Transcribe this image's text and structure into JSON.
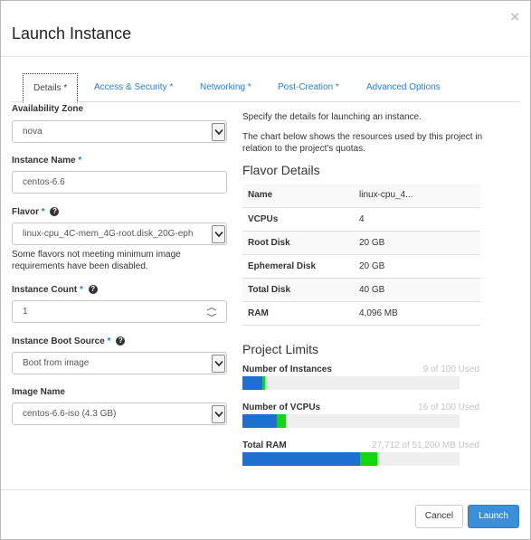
{
  "dialog": {
    "title": "Launch Instance",
    "close_glyph": "×"
  },
  "tabs": [
    {
      "label": "Details *",
      "active": true
    },
    {
      "label": "Access & Security *",
      "active": false
    },
    {
      "label": "Networking *",
      "active": false
    },
    {
      "label": "Post-Creation *",
      "active": false
    },
    {
      "label": "Advanced Options",
      "active": false
    }
  ],
  "form": {
    "availability_zone": {
      "label": "Availability Zone",
      "value": "nova"
    },
    "instance_name": {
      "label": "Instance Name",
      "required": "*",
      "value": "centos-6.6"
    },
    "flavor": {
      "label": "Flavor",
      "required": "*",
      "value": "linux-cpu_4C-mem_4G-root.disk_20G-eph",
      "note": "Some flavors not meeting minimum image requirements have been disabled."
    },
    "instance_count": {
      "label": "Instance Count",
      "required": "*",
      "value": "1"
    },
    "boot_source": {
      "label": "Instance Boot Source",
      "required": "*",
      "value": "Boot from image"
    },
    "image_name": {
      "label": "Image Name",
      "value": "centos-6.6-iso (4.3 GB)"
    }
  },
  "help": {
    "text1": "Specify the details for launching an instance.",
    "text2": "The chart below shows the resources used by this project in relation to the project's quotas."
  },
  "flavor_details": {
    "title": "Flavor Details",
    "rows": [
      {
        "key": "Name",
        "value": "linux-cpu_4..."
      },
      {
        "key": "VCPUs",
        "value": "4"
      },
      {
        "key": "Root Disk",
        "value": "20 GB"
      },
      {
        "key": "Ephemeral Disk",
        "value": "20 GB"
      },
      {
        "key": "Total Disk",
        "value": "40 GB"
      },
      {
        "key": "RAM",
        "value": "4,096 MB"
      }
    ]
  },
  "project_limits": {
    "title": "Project Limits",
    "items": [
      {
        "label": "Number of Instances",
        "used_text": "9 of 100 Used",
        "used": 9,
        "adding": 1,
        "total": 100
      },
      {
        "label": "Number of VCPUs",
        "used_text": "16 of 100 Used",
        "used": 16,
        "adding": 4,
        "total": 100
      },
      {
        "label": "Total RAM",
        "used_text": "27,712 of 51,200 MB Used",
        "used": 27712,
        "adding": 4096,
        "total": 51200
      }
    ],
    "colors": {
      "current": "#1e6fcf",
      "added": "#12d612",
      "empty": "#efefef"
    }
  },
  "footer": {
    "cancel_label": "Cancel",
    "launch_label": "Launch"
  },
  "icons": {
    "help": "question-circle-icon",
    "select": "chevron-down-icon",
    "spinner": "number-spinner-icon"
  },
  "accent_color": "#2a7fcb"
}
